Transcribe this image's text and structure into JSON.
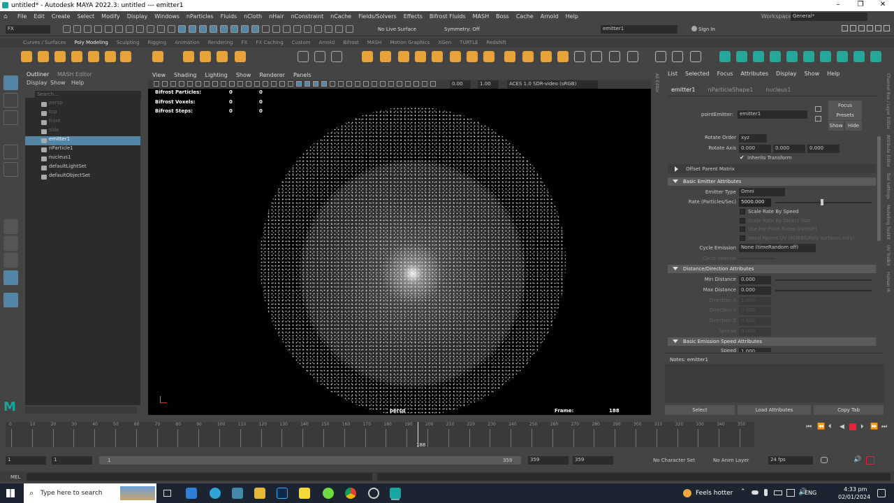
{
  "window": {
    "title": "untitled* - Autodesk MAYA 2022.3: untitled   ---   emitter1",
    "min": "–",
    "restore": "❐",
    "close": "✕"
  },
  "menubar": {
    "items": [
      "File",
      "Edit",
      "Create",
      "Select",
      "Modify",
      "Display",
      "Windows",
      "nParticles",
      "Fluids",
      "nCloth",
      "nHair",
      "nConstraint",
      "nCache",
      "Fields/Solvers",
      "Effects",
      "Bifrost Fluids",
      "MASH",
      "Boss",
      "Cache",
      "Arnold",
      "Help"
    ],
    "workspace_label": "Workspace :",
    "workspace_value": "General*"
  },
  "status": {
    "menuset": "FX",
    "live_surface": "No Live Surface",
    "symmetry": "Symmetry: Off",
    "name_field": "emitter1",
    "sign_in": "Sign In"
  },
  "shelf": {
    "tabs": [
      "Curves / Surfaces",
      "Poly Modeling",
      "Sculpting",
      "Rigging",
      "Animation",
      "Rendering",
      "FX",
      "FX Caching",
      "Custom",
      "Arnold",
      "Bifrost",
      "MASH",
      "Motion Graphics",
      "XGen",
      "TURTLE",
      "Redshift"
    ],
    "active": "Poly Modeling"
  },
  "outliner": {
    "tabs": [
      "Outliner",
      "MASH Editor"
    ],
    "menu": [
      "Display",
      "Show",
      "Help"
    ],
    "search_placeholder": "Search...",
    "items": [
      {
        "label": "persp",
        "dim": true
      },
      {
        "label": "top",
        "dim": true
      },
      {
        "label": "front",
        "dim": true
      },
      {
        "label": "side",
        "dim": true
      },
      {
        "label": "emitter1",
        "selected": true
      },
      {
        "label": "nParticle1"
      },
      {
        "label": "nucleus1"
      },
      {
        "label": "defaultLightSet"
      },
      {
        "label": "defaultObjectSet"
      }
    ]
  },
  "viewport": {
    "menu": [
      "View",
      "Shading",
      "Lighting",
      "Show",
      "Renderer",
      "Panels"
    ],
    "gamma": "0.00",
    "exposure": "1.00",
    "colorspace": "ACES 1.0 SDR-video (sRGB)",
    "hud": [
      {
        "label": "Bifrost Particles:",
        "a": "0",
        "b": "0"
      },
      {
        "label": "Bifrost Voxels:",
        "a": "0",
        "b": "0"
      },
      {
        "label": "Bifrost Steps:",
        "a": "0",
        "b": "0"
      }
    ],
    "camera": "persp",
    "frame_label": "Frame:",
    "frame_value": "188"
  },
  "attr": {
    "menu": [
      "List",
      "Selected",
      "Focus",
      "Attributes",
      "Display",
      "Show",
      "Help"
    ],
    "tabs": [
      "emitter1",
      "nParticleShape1",
      "nucleus1"
    ],
    "node_label": "pointEmitter:",
    "node_value": "emitter1",
    "focus": "Focus",
    "presets": "Presets",
    "show": "Show",
    "hide": "Hide",
    "rotate_order_label": "Rotate Order",
    "rotate_order": "xyz",
    "rotate_axis_label": "Rotate Axis",
    "rotate_axis": [
      "0.000",
      "0.000",
      "0.000"
    ],
    "inherits": "Inherits Transform",
    "offset_parent": "Offset Parent Matrix",
    "sec_basic": "Basic Emitter Attributes",
    "emitter_type_label": "Emitter Type",
    "emitter_type": "Omni",
    "rate_label": "Rate (Particles/Sec)",
    "rate": "5000.000",
    "checks": [
      "Scale Rate By Speed",
      "Scale Rate By Object Size",
      "Use Per-Point Rates (rateVP)",
      "Need Parent UV (NURBS/Poly surfaces only)"
    ],
    "cycle_label": "Cycle Emission",
    "cycle": "None (timeRandom off)",
    "cycle_interval_label": "Cycle Interval",
    "sec_dist": "Distance/Direction Attributes",
    "min_dist_label": "Min Distance",
    "min_dist": "0.000",
    "max_dist_label": "Max Distance",
    "max_dist": "0.000",
    "dir_x_label": "Direction X",
    "dir_x": "1.000",
    "dir_y_label": "Direction Y",
    "dir_y": "0.000",
    "dir_z_label": "Direction Z",
    "dir_z": "0.000",
    "spread_label": "Spread",
    "spread": "0.000",
    "sec_speed": "Basic Emission Speed Attributes",
    "speed_label": "Speed",
    "speed": "1.000",
    "notes": "Notes:  emitter1",
    "btn_select": "Select",
    "btn_load": "Load Attributes",
    "btn_copy": "Copy Tab"
  },
  "side_tabs": [
    "Channel Box / Layer Editor",
    "Attribute Editor",
    "Tool Settings",
    "Modelling Toolkit",
    "UV Toolkit",
    "Human IK"
  ],
  "ae_side": "AE Editor",
  "timeline": {
    "ticks": [
      "0",
      "10",
      "20",
      "30",
      "40",
      "50",
      "60",
      "70",
      "80",
      "90",
      "100",
      "110",
      "120",
      "130",
      "140",
      "150",
      "160",
      "170",
      "180",
      "190",
      "200",
      "210",
      "220",
      "230",
      "240",
      "250",
      "260",
      "270",
      "280",
      "290",
      "300",
      "310",
      "320",
      "330",
      "340",
      "350"
    ],
    "current": "188",
    "start": "1",
    "range_start": "1",
    "range_inner_start": "1",
    "range_inner_end": "359",
    "range_end": "359",
    "end": "359",
    "char_set": "No Character Set",
    "anim_layer": "No Anim Layer",
    "fps": "24 fps"
  },
  "mel": "MEL",
  "taskbar": {
    "search": "Type here to search",
    "weather": "Feels hotter",
    "lang": "ENG",
    "time": "4:33 pm",
    "date": "02/01/2024"
  },
  "colors": {
    "accent": "#5285a6",
    "shelf_orange": "#e8a23a",
    "shelf_teal": "#27a69b",
    "record": "#e0283a"
  }
}
